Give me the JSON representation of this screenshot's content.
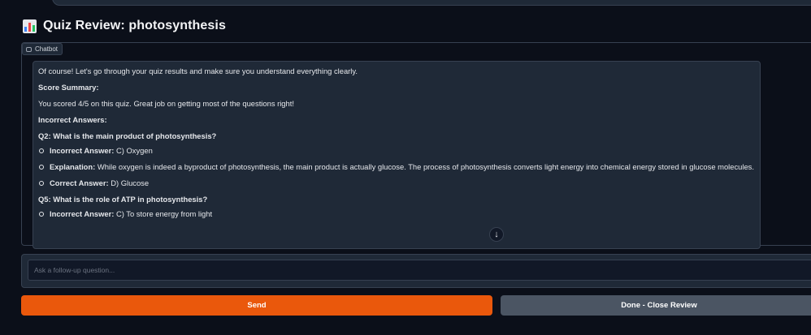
{
  "header": {
    "icon": "bar-chart-icon",
    "title": "Quiz Review: photosynthesis"
  },
  "chatbot": {
    "label": "Chatbot",
    "label_icon": "chat-bubble-icon",
    "message": {
      "intro": "Of course! Let's go through your quiz results and make sure you understand everything clearly.",
      "score_heading": "Score Summary:",
      "score_text": "You scored 4/5 on this quiz. Great job on getting most of the questions right!",
      "incorrect_heading": "Incorrect Answers:",
      "questions": [
        {
          "question": "Q2: What is the main product of photosynthesis?",
          "items": [
            {
              "label": "Incorrect Answer:",
              "text": " C) Oxygen"
            },
            {
              "label": "Explanation:",
              "text": " While oxygen is indeed a byproduct of photosynthesis, the main product is actually glucose. The process of photosynthesis converts light energy into chemical energy stored in glucose molecules."
            },
            {
              "label": "Correct Answer:",
              "text": " D) Glucose"
            }
          ]
        },
        {
          "question": "Q5: What is the role of ATP in photosynthesis?",
          "items": [
            {
              "label": "Incorrect Answer:",
              "text": " C) To store energy from light"
            }
          ]
        }
      ]
    },
    "scroll_icon": "arrow-down-icon"
  },
  "followup": {
    "placeholder": "Ask a follow-up question...",
    "value": ""
  },
  "buttons": {
    "send": "Send",
    "done": "Done - Close Review"
  },
  "colors": {
    "background": "#0b0f19",
    "panel": "#1f2937",
    "send_button": "#ea580c",
    "done_button": "#4b5563"
  }
}
